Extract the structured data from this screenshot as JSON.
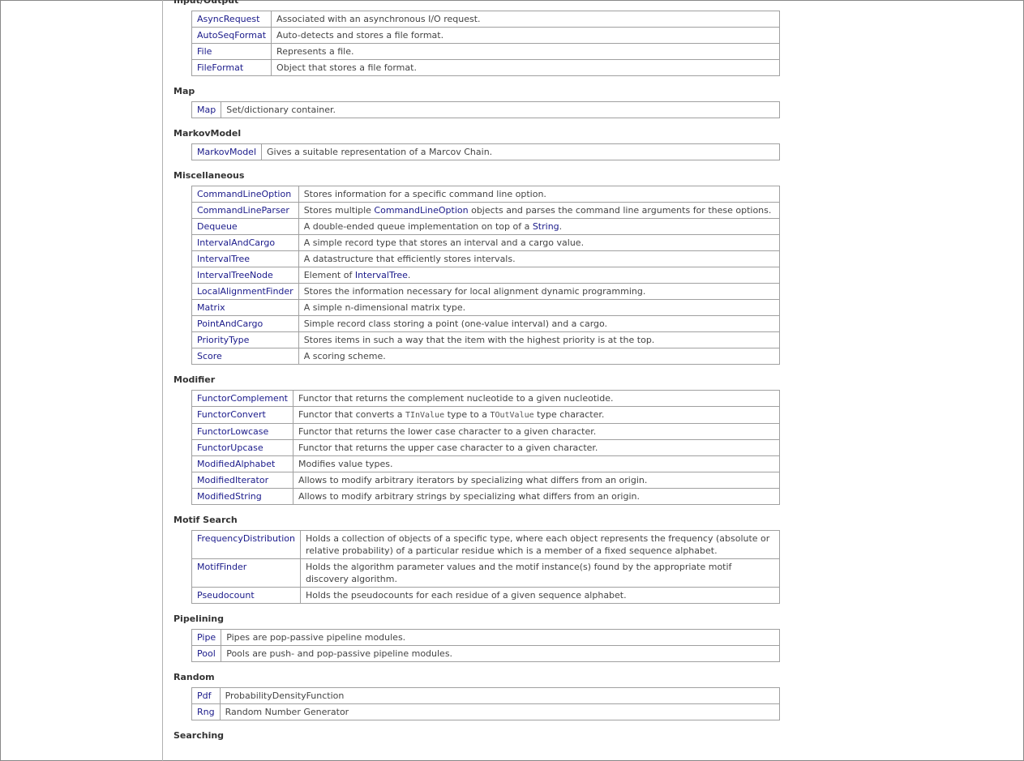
{
  "sections": [
    {
      "title": "Input/Output",
      "rows": [
        {
          "name": "AsyncRequest",
          "desc": [
            {
              "t": "Associated with an asynchronous I/O request."
            }
          ]
        },
        {
          "name": "AutoSeqFormat",
          "desc": [
            {
              "t": "Auto-detects and stores a file format."
            }
          ]
        },
        {
          "name": "File",
          "desc": [
            {
              "t": "Represents a file."
            }
          ]
        },
        {
          "name": "FileFormat",
          "desc": [
            {
              "t": "Object that stores a file format."
            }
          ]
        }
      ]
    },
    {
      "title": "Map",
      "rows": [
        {
          "name": "Map",
          "desc": [
            {
              "t": "Set/dictionary container."
            }
          ]
        }
      ]
    },
    {
      "title": "MarkovModel",
      "rows": [
        {
          "name": "MarkovModel",
          "desc": [
            {
              "t": "Gives a suitable representation of a Marcov Chain."
            }
          ]
        }
      ]
    },
    {
      "title": "Miscellaneous",
      "rows": [
        {
          "name": "CommandLineOption",
          "desc": [
            {
              "t": "Stores information for a specific command line option."
            }
          ]
        },
        {
          "name": "CommandLineParser",
          "desc": [
            {
              "t": "Stores multiple "
            },
            {
              "t": "CommandLineOption",
              "link": true
            },
            {
              "t": " objects and parses the command line arguments for these options."
            }
          ]
        },
        {
          "name": "Dequeue",
          "desc": [
            {
              "t": "A double-ended queue implementation on top of a "
            },
            {
              "t": "String",
              "link": true
            },
            {
              "t": "."
            }
          ]
        },
        {
          "name": "IntervalAndCargo",
          "desc": [
            {
              "t": "A simple record type that stores an interval and a cargo value."
            }
          ]
        },
        {
          "name": "IntervalTree",
          "desc": [
            {
              "t": "A datastructure that efficiently stores intervals."
            }
          ]
        },
        {
          "name": "IntervalTreeNode",
          "desc": [
            {
              "t": "Element of "
            },
            {
              "t": "IntervalTree",
              "link": true
            },
            {
              "t": "."
            }
          ]
        },
        {
          "name": "LocalAlignmentFinder",
          "desc": [
            {
              "t": "Stores the information necessary for local alignment dynamic programming."
            }
          ]
        },
        {
          "name": "Matrix",
          "desc": [
            {
              "t": "A simple n-dimensional matrix type."
            }
          ]
        },
        {
          "name": "PointAndCargo",
          "desc": [
            {
              "t": "Simple record class storing a point (one-value interval) and a cargo."
            }
          ]
        },
        {
          "name": "PriorityType",
          "desc": [
            {
              "t": "Stores items in such a way that the item with the highest priority is at the top."
            }
          ]
        },
        {
          "name": "Score",
          "desc": [
            {
              "t": "A scoring scheme."
            }
          ]
        }
      ]
    },
    {
      "title": "Modifier",
      "rows": [
        {
          "name": "FunctorComplement",
          "desc": [
            {
              "t": "Functor that returns the complement nucleotide to a given nucleotide."
            }
          ]
        },
        {
          "name": "FunctorConvert",
          "desc": [
            {
              "t": "Functor that converts a "
            },
            {
              "t": "TInValue",
              "code": true
            },
            {
              "t": " type to a "
            },
            {
              "t": "TOutValue",
              "code": true
            },
            {
              "t": " type character."
            }
          ]
        },
        {
          "name": "FunctorLowcase",
          "desc": [
            {
              "t": "Functor that returns the lower case character to a given character."
            }
          ]
        },
        {
          "name": "FunctorUpcase",
          "desc": [
            {
              "t": "Functor that returns the upper case character to a given character."
            }
          ]
        },
        {
          "name": "ModifiedAlphabet",
          "desc": [
            {
              "t": "Modifies value types."
            }
          ]
        },
        {
          "name": "ModifiedIterator",
          "desc": [
            {
              "t": "Allows to modify arbitrary iterators by specializing what differs from an origin."
            }
          ]
        },
        {
          "name": "ModifiedString",
          "desc": [
            {
              "t": "Allows to modify arbitrary strings by specializing what differs from an origin."
            }
          ]
        }
      ]
    },
    {
      "title": "Motif Search",
      "rows": [
        {
          "name": "FrequencyDistribution",
          "desc": [
            {
              "t": "Holds a collection of objects of a specific type, where each object represents the frequency (absolute or relative probability) of a particular residue which is a member of a fixed sequence alphabet."
            }
          ]
        },
        {
          "name": "MotifFinder",
          "desc": [
            {
              "t": "Holds the algorithm parameter values and the motif instance(s) found by the appropriate motif discovery algorithm."
            }
          ]
        },
        {
          "name": "Pseudocount",
          "desc": [
            {
              "t": "Holds the pseudocounts for each residue of a given sequence alphabet."
            }
          ]
        }
      ]
    },
    {
      "title": "Pipelining",
      "rows": [
        {
          "name": "Pipe",
          "desc": [
            {
              "t": "Pipes are pop-passive pipeline modules."
            }
          ]
        },
        {
          "name": "Pool",
          "desc": [
            {
              "t": "Pools are push- and pop-passive pipeline modules."
            }
          ]
        }
      ]
    },
    {
      "title": "Random",
      "rows": [
        {
          "name": "Pdf",
          "desc": [
            {
              "t": "ProbabilityDensityFunction"
            }
          ]
        },
        {
          "name": "Rng",
          "desc": [
            {
              "t": "Random Number Generator"
            }
          ]
        }
      ]
    },
    {
      "title": "Searching",
      "rows": []
    }
  ]
}
